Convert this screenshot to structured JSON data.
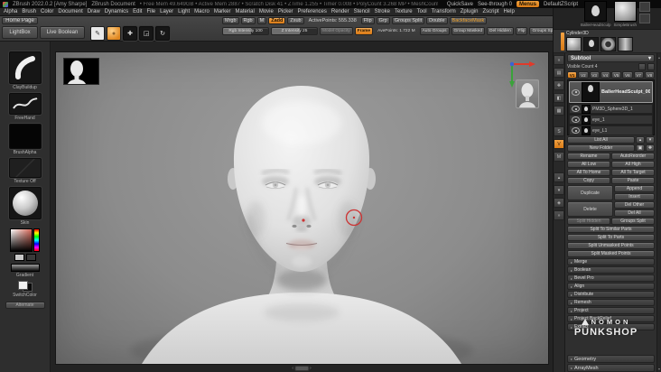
{
  "glyphs": {
    "collapse_left": "«",
    "expand_right": "»",
    "up": "▴",
    "down": "▾",
    "section_arrow": "▸",
    "prev": "‹",
    "next": "›",
    "plus": "✚",
    "folder": "▣"
  },
  "title_bar": {
    "app_title": "ZBrush 2022.0.2 [Amy Sharpe]",
    "document_title": "ZBrush Document",
    "stats": "•  Free Mem 49.649GB   •  Active Mem 2887   •  Scratch Disk 41   •  ZTime 1.255   •  Timer 0.008   •  PolyCount 3.268 MP   •  MeshCount 2",
    "quicksave_label": "QuickSave",
    "see_through_label": "See-through 0",
    "menus_label": "Menus",
    "default_zscript_label": "DefaultZScript"
  },
  "menu_bar": {
    "items": [
      "Alpha",
      "Brush",
      "Color",
      "Document",
      "Draw",
      "Dynamics",
      "Edit",
      "File",
      "Layer",
      "Light",
      "Macro",
      "Marker",
      "Material",
      "Movie",
      "Picker",
      "Preferences",
      "Render",
      "Stencil",
      "Stroke",
      "Texture",
      "Tool",
      "Transform",
      "Zplugin",
      "Zscript",
      "Help"
    ]
  },
  "toolbar": {
    "home_page_label": "Home Page",
    "lightbox_label": "LightBox",
    "live_boolean_label": "Live Boolean",
    "icons": [
      {
        "name": "brush-edit-icon",
        "glyph": "✎",
        "cls": "tile-white"
      },
      {
        "name": "draw-pointer-icon",
        "glyph": "●",
        "cls": "tile-orange"
      },
      {
        "name": "move-icon",
        "glyph": "✚",
        "cls": "tile"
      },
      {
        "name": "scale-icon",
        "glyph": "◲",
        "cls": "tile"
      },
      {
        "name": "rotate-icon",
        "glyph": "↻",
        "cls": "tile"
      }
    ],
    "row1": [
      {
        "label": "Mrgb",
        "name": "mrgb-button"
      },
      {
        "label": "Rgb",
        "name": "rgb-button"
      },
      {
        "label": "M",
        "name": "m-button"
      },
      {
        "label": "Zadd",
        "name": "zadd-button",
        "cls": "orange"
      },
      {
        "label": "Zsub",
        "name": "zsub-button"
      },
      {
        "label": "ActivePoints: 555.338",
        "name": "active-points-readout",
        "cls": "plain"
      },
      {
        "label": "Flip",
        "name": "flip-button"
      },
      {
        "label": "Grp",
        "name": "grp-button"
      },
      {
        "label": "Groups Split",
        "name": "groups-split-button"
      },
      {
        "label": "Double",
        "name": "double-button"
      },
      {
        "label": "BackfaceMask",
        "name": "backface-mask-button",
        "cls": "orange-text"
      }
    ],
    "row2": [
      {
        "label": "Rgb Intensity 100",
        "name": "rgb-intensity-slider",
        "cls": "slider"
      },
      {
        "label": "Z Intensity 25",
        "name": "z-intensity-slider",
        "cls": "slider"
      },
      {
        "label": "Model Opacity",
        "name": "model-opacity-button",
        "cls": "dim"
      },
      {
        "label": "Frame",
        "name": "frame-button",
        "cls": "orange"
      },
      {
        "label": "AvePoints: 1.722 M",
        "name": "ave-points-readout",
        "cls": "plain"
      },
      {
        "label": "Auto Groups",
        "name": "auto-groups-button"
      },
      {
        "label": "Group Masked",
        "name": "group-masked-button"
      },
      {
        "label": "Del Hidden",
        "name": "del-hidden-button"
      },
      {
        "label": "Flip",
        "name": "flip-row2-button"
      },
      {
        "label": "Groups Split",
        "name": "groups-split-row2-button"
      }
    ]
  },
  "left_shelf": {
    "brush_label": "ClayBuildup",
    "stroke_label": "FreeHand",
    "alpha_label": "BrushAlpha",
    "texture_label": "Texture Off",
    "material_label": "Skin",
    "gradient_label": "Gradient",
    "switch_label": "SwitchColor",
    "alternate_label": "Alternate"
  },
  "canvas": {
    "watermark_line1": "NOMON",
    "watermark_line2": "PUNKSHOP"
  },
  "right_tray": {
    "tool_preview_label": "BallerHeadSculp",
    "brush_preview_label": "SimpleBrush",
    "tool_row_label": "Cylinder3D",
    "strip_icons": [
      {
        "glyph": "«",
        "name": "collapse-tray-icon"
      },
      {
        "glyph": "▤",
        "name": "list-icon"
      },
      {
        "glyph": "✚",
        "name": "move-gizmo-icon"
      },
      {
        "glyph": "◧",
        "name": "split-view-icon"
      },
      {
        "glyph": "▦",
        "name": "grid-icon"
      },
      {
        "glyph": "",
        "name": "strip-spacer",
        "cls": "spacer"
      },
      {
        "glyph": "S",
        "name": "smooth-icon"
      },
      {
        "glyph": "V",
        "name": "visibility-icon",
        "cls": "orange"
      },
      {
        "glyph": "M",
        "name": "mask-icon"
      },
      {
        "glyph": "",
        "name": "strip-spacer",
        "cls": "spacer"
      },
      {
        "glyph": "▴",
        "name": "scroll-up-icon"
      },
      {
        "glyph": "▾",
        "name": "scroll-down-icon"
      },
      {
        "glyph": "◈",
        "name": "material-icon"
      },
      {
        "glyph": "»",
        "name": "expand-tray-icon"
      }
    ],
    "subtool": {
      "header_label": "Subtool",
      "visible_count_label": "Visible Count 4",
      "versions": [
        {
          "label": "V1",
          "cls": "orange"
        },
        {
          "label": "V2"
        },
        {
          "label": "V3"
        },
        {
          "label": "V4"
        },
        {
          "label": "V5"
        },
        {
          "label": "V6"
        },
        {
          "label": "V7"
        },
        {
          "label": "V8"
        }
      ],
      "selected_item_name": "BallerHeadSculpt_003",
      "items": [
        {
          "name": "PM3D_Sphere3D_1"
        },
        {
          "name": "eye_1"
        },
        {
          "name": "eye_L1"
        }
      ],
      "list_all_label": "List All",
      "new_folder_label": "New Folder",
      "grid_rows": [
        {
          "left": "Rename",
          "right": "AutoReorder"
        },
        {
          "left": "All Low",
          "right": "All High"
        },
        {
          "left": "All To Home",
          "right": "All To Target"
        },
        {
          "left": "Copy",
          "right": "Paste"
        }
      ],
      "duplicate_label": "Duplicate",
      "append_label": "Append",
      "insert_label": "Insert",
      "delete_label": "Delete",
      "del_other_label": "Del Other",
      "del_all_label": "Del All",
      "split_hidden_label": "Split Hidden",
      "groups_split_label": "Groups Split",
      "split_buttons": [
        "Split To Similar Parts",
        "Split To Parts",
        "Split Unmasked Points",
        "Split Masked Points"
      ],
      "sections": [
        "Merge",
        "Boolean",
        "Bevel Pro",
        "Align",
        "Distribute",
        "Remesh",
        "Project",
        "Project BackRelief",
        "Extract"
      ],
      "bottom_sections": [
        "Geometry",
        "ArrayMesh"
      ]
    }
  }
}
